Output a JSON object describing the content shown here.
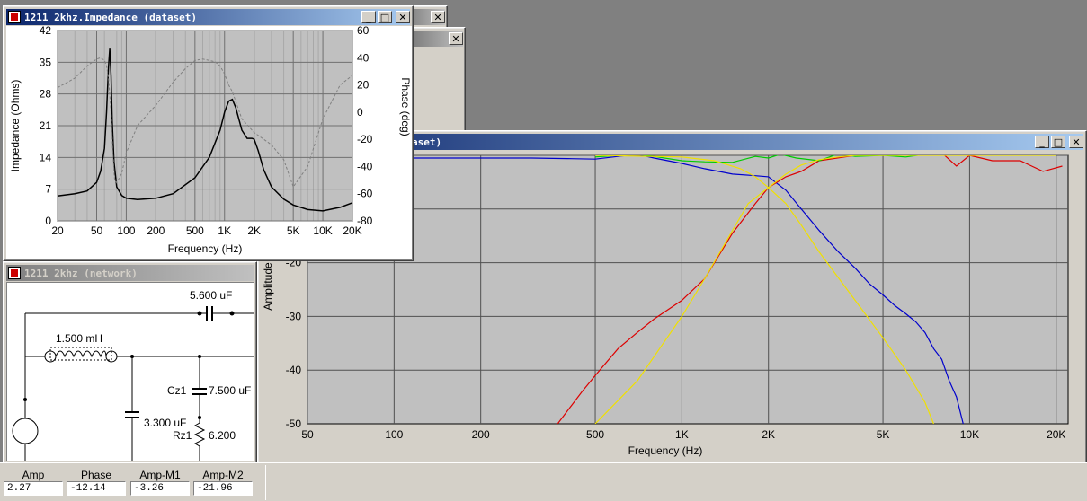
{
  "impedance_window": {
    "title": "1211 2khz.Impedance (dataset)",
    "chart_data": {
      "type": "line",
      "xlabel": "Frequency (Hz)",
      "ylabel_left": "Impedance (Ohms)",
      "ylabel_right": "Phase (deg)",
      "xscale": "log",
      "xlim": [
        20,
        20000
      ],
      "ylim_left": [
        0,
        42
      ],
      "ylim_right": [
        -80,
        60
      ],
      "x_ticks": [
        "20",
        "50",
        "100",
        "200",
        "500",
        "1K",
        "2K",
        "5K",
        "10K",
        "20K"
      ],
      "y_ticks_left": [
        "0",
        "7",
        "14",
        "21",
        "28",
        "35",
        "42"
      ],
      "y_ticks_right": [
        "-80",
        "-60",
        "-40",
        "-20",
        "0",
        "20",
        "40",
        "60"
      ],
      "grid": true,
      "series": [
        {
          "axis": "left",
          "color": "#000000",
          "style": "solid",
          "x": [
            20,
            30,
            40,
            50,
            55,
            60,
            63,
            66,
            68,
            70,
            72,
            75,
            80,
            90,
            100,
            130,
            200,
            300,
            500,
            700,
            900,
            1000,
            1100,
            1200,
            1300,
            1500,
            1700,
            1900,
            2000,
            2200,
            2500,
            3000,
            4000,
            5000,
            7000,
            10000,
            15000,
            20000
          ],
          "y": [
            5.5,
            6,
            6.6,
            8.5,
            11,
            16,
            24,
            34,
            38,
            32,
            22,
            13,
            7.5,
            5.6,
            5,
            4.7,
            5,
            6,
            9.5,
            14,
            20,
            24,
            26.4,
            26.8,
            25,
            20,
            18.2,
            18.2,
            18,
            15.5,
            11.3,
            7.5,
            4.8,
            3.5,
            2.5,
            2.2,
            3,
            4
          ]
        },
        {
          "axis": "right",
          "color": "#808080",
          "style": "dashed",
          "x": [
            20,
            30,
            40,
            50,
            55,
            60,
            63,
            66,
            70,
            73,
            76,
            80,
            90,
            100,
            130,
            200,
            300,
            400,
            500,
            600,
            700,
            800,
            900,
            1000,
            1100,
            1200,
            1500,
            2000,
            3000,
            4000,
            5000,
            7000,
            10000,
            15000,
            20000
          ],
          "y": [
            18,
            25,
            34,
            39,
            40,
            38,
            34,
            25,
            0,
            -30,
            -49,
            -52,
            -45,
            -30,
            -10,
            5,
            22,
            32,
            38,
            39,
            38,
            37,
            34,
            28,
            20,
            15,
            -5,
            -15,
            -24,
            -35,
            -55,
            -40,
            -5,
            20,
            27
          ]
        }
      ]
    }
  },
  "freq_window": {
    "title": "aset)",
    "chart_data": {
      "type": "line",
      "xlabel": "Frequency (Hz)",
      "ylabel": "Amplitude",
      "xscale": "log",
      "xlim": [
        50,
        22000
      ],
      "ylim": [
        -50,
        0
      ],
      "x_ticks": [
        "50",
        "100",
        "200",
        "500",
        "1K",
        "2K",
        "5K",
        "10K",
        "20K"
      ],
      "y_ticks": [
        "-20",
        "-30",
        "-40",
        "-50"
      ],
      "grid": true,
      "series": [
        {
          "color": "#0000cc",
          "x": [
            100,
            150,
            200,
            300,
            400,
            500,
            600,
            700,
            800,
            1000,
            1200,
            1500,
            1800,
            2000,
            2300,
            2600,
            3000,
            3500,
            4000,
            4500,
            5000,
            5500,
            6000,
            6500,
            7000,
            7500,
            8000,
            8500,
            9000,
            9500
          ],
          "y": [
            -0.5,
            -0.5,
            -0.5,
            -0.5,
            -0.6,
            -0.7,
            -0.2,
            0.2,
            -0.5,
            -1.5,
            -2.5,
            -3.5,
            -3.8,
            -4,
            -6.5,
            -10,
            -14,
            -18,
            -21,
            -24,
            -26,
            -28,
            -29.5,
            -31,
            -33,
            -36,
            -38,
            -42,
            -45,
            -50
          ]
        },
        {
          "color": "#dd0000",
          "x": [
            370,
            450,
            500,
            600,
            700,
            800,
            1000,
            1200,
            1500,
            1800,
            2000,
            2300,
            2600,
            3000,
            4000,
            5000,
            6000,
            7000,
            7500,
            8000,
            9000,
            10000,
            12000,
            15000,
            18000,
            21000
          ],
          "y": [
            -50,
            -44,
            -41,
            -36,
            -33,
            -30.5,
            -27,
            -23,
            -14.5,
            -9,
            -6,
            -4,
            -3,
            -1,
            0,
            0.5,
            0.5,
            1.5,
            2,
            0.5,
            -2,
            0,
            -1,
            -1,
            -3,
            -2
          ]
        },
        {
          "color": "#00cc00",
          "x": [
            500,
            600,
            700,
            800,
            1000,
            1200,
            1500,
            1800,
            2000,
            2200,
            2500,
            3000,
            3500,
            4000,
            5000,
            6000,
            7000,
            8000
          ],
          "y": [
            -0.3,
            0,
            0.2,
            -0.2,
            -1,
            -1.2,
            -1.3,
            -0.2,
            -0.5,
            0.2,
            -0.5,
            -1,
            0.3,
            -0.2,
            0,
            -0.3,
            0.2,
            0.5
          ]
        },
        {
          "color": "#f0e000",
          "x": [
            500,
            700,
            1000,
            1200,
            1500,
            1700,
            2000,
            2300,
            2600,
            3000,
            3500,
            4000,
            5000,
            6000,
            7000,
            7500,
            8000,
            9000,
            10000,
            15000,
            20000
          ],
          "y": [
            -50,
            -42,
            -30,
            -23,
            -14,
            -9,
            -6,
            -3.5,
            -1.8,
            -0.8,
            -0.3,
            0,
            0,
            0,
            0,
            0,
            0,
            0,
            0,
            0,
            0
          ]
        },
        {
          "color": "#f0e000",
          "x": [
            500,
            1000,
            1300,
            1600,
            1800,
            2000,
            2300,
            2600,
            3000,
            4000,
            5000,
            6000,
            7000,
            7500
          ],
          "y": [
            0,
            -0.3,
            -1,
            -2.5,
            -4,
            -6,
            -9,
            -13,
            -18,
            -27,
            -34,
            -40,
            -46,
            -50
          ]
        }
      ]
    }
  },
  "network_window": {
    "title": "1211 2khz (network)",
    "components": [
      {
        "id": "cap-top",
        "value": "5.600 uF"
      },
      {
        "id": "inductor",
        "value": "1.500 mH"
      },
      {
        "id": "cz1",
        "name": "Cz1",
        "value": "7.500 uF"
      },
      {
        "id": "cap-shunt",
        "value": "3.300 uF"
      },
      {
        "id": "rz1",
        "name": "Rz1",
        "value": "6.200"
      }
    ]
  },
  "status_bar": {
    "fields": [
      {
        "label": "Amp",
        "value": "2.27"
      },
      {
        "label": "Phase",
        "value": "-12.14"
      },
      {
        "label": "Amp-M1",
        "value": "-3.26"
      },
      {
        "label": "Amp-M2",
        "value": "-21.96"
      }
    ]
  }
}
